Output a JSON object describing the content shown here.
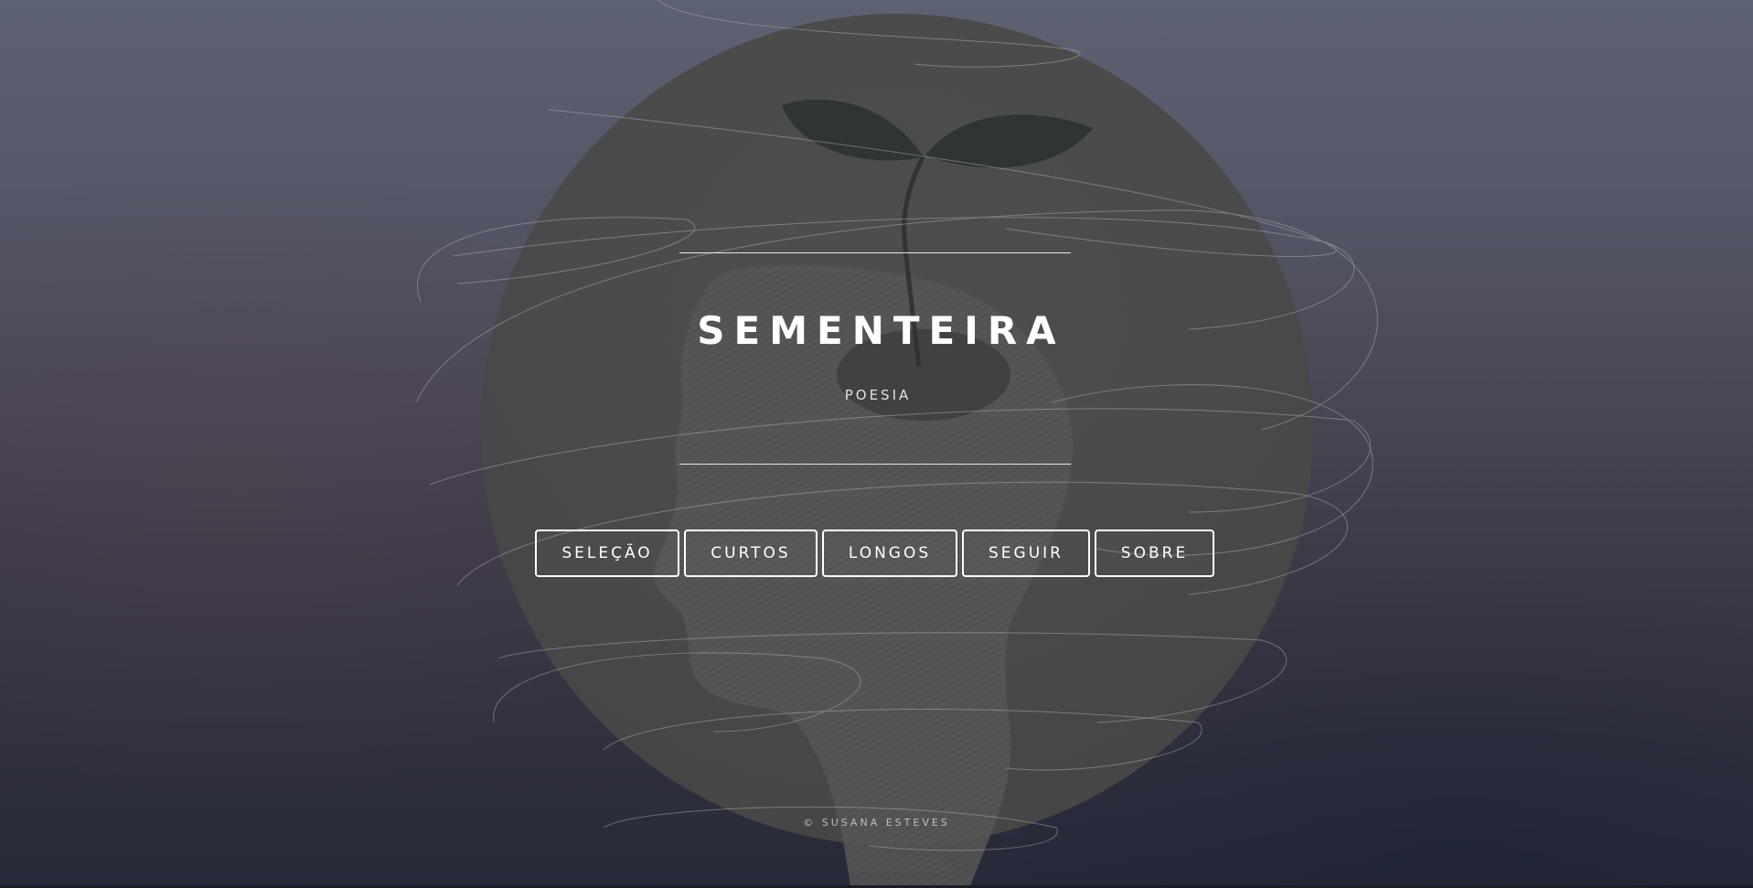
{
  "site": {
    "title": "SEMENTEIRA",
    "subtitle": "POESIA"
  },
  "nav": {
    "items": [
      {
        "label": "SELEÇÃO"
      },
      {
        "label": "CURTOS"
      },
      {
        "label": "LONGOS"
      },
      {
        "label": "SEGUIR"
      },
      {
        "label": "SOBRE"
      }
    ]
  },
  "footer": {
    "copyright": "© SUSANA ESTEVES"
  },
  "colors": {
    "background_top": "#5d6273",
    "background_bottom": "#262939",
    "circle": "#4b4c4b",
    "text": "#ffffff",
    "leaf": "#2c332f"
  },
  "artwork": {
    "subject": "head-with-sprout-illustration"
  }
}
